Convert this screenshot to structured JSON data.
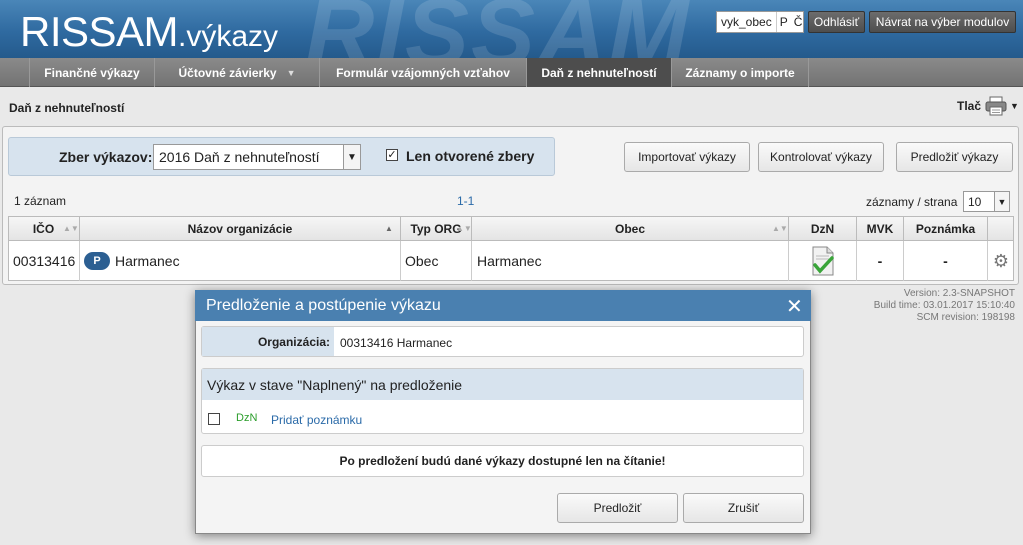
{
  "header": {
    "logo_main": "RISSAM",
    "logo_sub": ".výkazy",
    "bg_text": "RISSAM",
    "username": "vyk_obec",
    "lang_p": "P",
    "lang_c": "Č",
    "logout": "Odhlásiť",
    "back": "Návrat na výber modulov"
  },
  "nav": {
    "tabs": [
      {
        "label": "Finančné výkazy"
      },
      {
        "label": "Účtovné závierky"
      },
      {
        "label": "Formulár vzájomných vzťahov"
      },
      {
        "label": "Daň z nehnuteľností"
      },
      {
        "label": "Záznamy o importe"
      }
    ],
    "active_index": 3
  },
  "breadcrumb": "Daň z nehnuteľností",
  "print_label": "Tlač",
  "filter": {
    "label": "Zber výkazov:",
    "selected": "2016 Daň z nehnuteľností",
    "only_open_label": "Len otvorené zbery",
    "only_open_checked": true
  },
  "actions": {
    "import": "Importovať výkazy",
    "check": "Kontrolovať výkazy",
    "submit": "Predložiť výkazy"
  },
  "list": {
    "count": "1 záznam",
    "pager": "1-1",
    "per_page_label": "záznamy / strana",
    "per_page_value": "10"
  },
  "table": {
    "columns": [
      "IČO",
      "Názov organizácie",
      "Typ ORG",
      "Obec",
      "DzN",
      "MVK",
      "Poznámka"
    ],
    "rows": [
      {
        "ico": "00313416",
        "badge": "P",
        "name": "Harmanec",
        "typ": "Obec",
        "obec": "Harmanec",
        "mvk": "-",
        "poznamka": "-"
      }
    ]
  },
  "version": {
    "line1": "Version: 2.3-SNAPSHOT",
    "line2": "Build time: 03.01.2017 15:10:40",
    "line3": "SCM revision: 198198"
  },
  "modal": {
    "title": "Predloženie a postúpenie výkazu",
    "org_label": "Organizácia:",
    "org_value": "00313416 Harmanec",
    "section_title": "Výkaz v stave \"Naplnený\" na predloženie",
    "item_code": "DzN",
    "add_note": "Pridať poznámku",
    "warning": "Po predložení budú dané výkazy dostupné len na čítanie!",
    "submit": "Predložiť",
    "cancel": "Zrušiť"
  },
  "colors": {
    "header_blue": "#2f6aa0",
    "modal_blue": "#4a80b0",
    "light_blue": "#d7e3ee",
    "dzn_green": "#2a9d2a"
  }
}
